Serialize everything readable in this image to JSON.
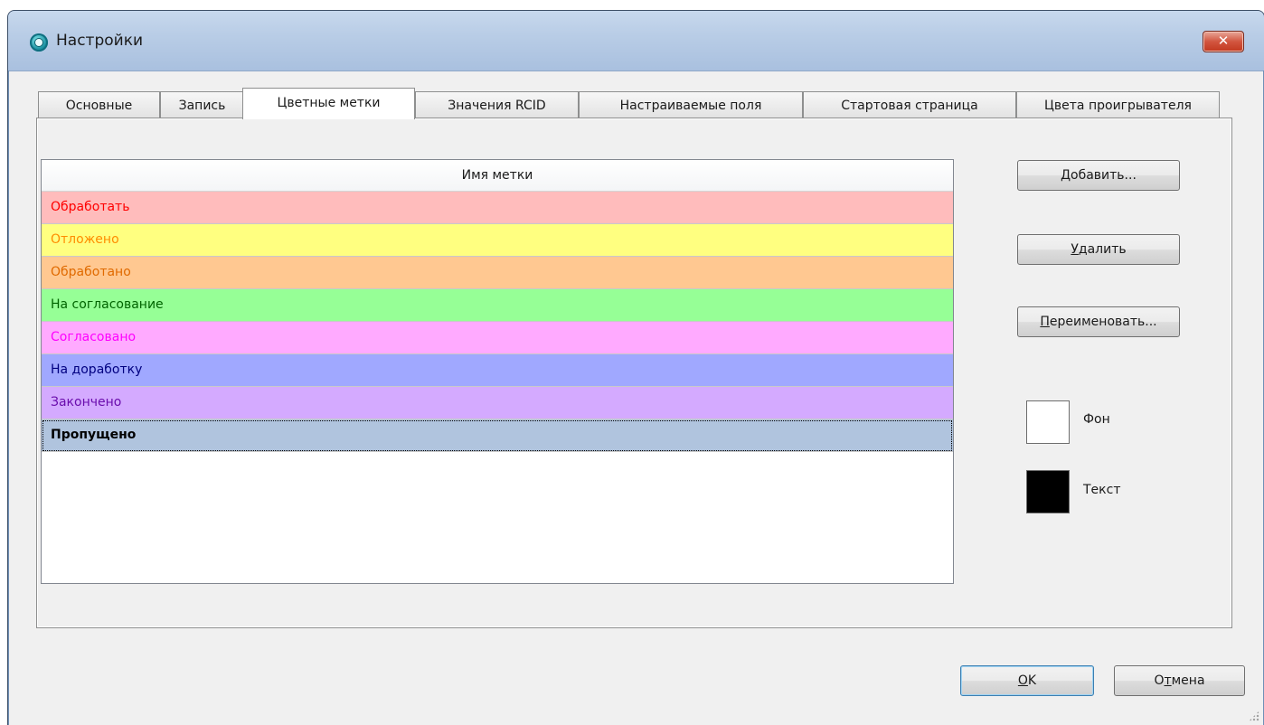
{
  "window": {
    "title": "Настройки",
    "close_label": "✕"
  },
  "tabs": [
    {
      "label": "Основные"
    },
    {
      "label": "Запись"
    },
    {
      "label": "Цветные метки",
      "active": true
    },
    {
      "label": "Значения RCID"
    },
    {
      "label": "Настраиваемые поля"
    },
    {
      "label": "Стартовая страница"
    },
    {
      "label": "Цвета проигрывателя"
    }
  ],
  "list": {
    "header": "Имя метки",
    "rows": [
      {
        "label": "Обработать",
        "bg": "#ffbcbc",
        "fg": "#ff0000"
      },
      {
        "label": "Отложено",
        "bg": "#ffff80",
        "fg": "#ff8c00"
      },
      {
        "label": "Обработано",
        "bg": "#ffc891",
        "fg": "#e06a00"
      },
      {
        "label": "На согласование",
        "bg": "#96ff96",
        "fg": "#006400"
      },
      {
        "label": "Согласовано",
        "bg": "#ffaaff",
        "fg": "#ff00ff"
      },
      {
        "label": "На доработку",
        "bg": "#a0a8ff",
        "fg": "#000080"
      },
      {
        "label": "Закончено",
        "bg": "#d4aaff",
        "fg": "#6a0dad"
      },
      {
        "label": "Пропущено",
        "bg": "#b0c4de",
        "fg": "#000000",
        "selected": true
      }
    ]
  },
  "buttons": {
    "add": {
      "hotkey": "Д",
      "rest": "обавить..."
    },
    "delete": {
      "hotkey": "У",
      "rest": "далить"
    },
    "rename": {
      "hotkey": "П",
      "rest": "ереименовать..."
    },
    "ok": {
      "hotkey": "O",
      "rest": "K"
    },
    "cancel": {
      "pre": "О",
      "hotkey": "т",
      "rest": "мена"
    }
  },
  "colors": {
    "background_label": "Фон",
    "background_color": "#ffffff",
    "text_label": "Текст",
    "text_color": "#000000"
  }
}
